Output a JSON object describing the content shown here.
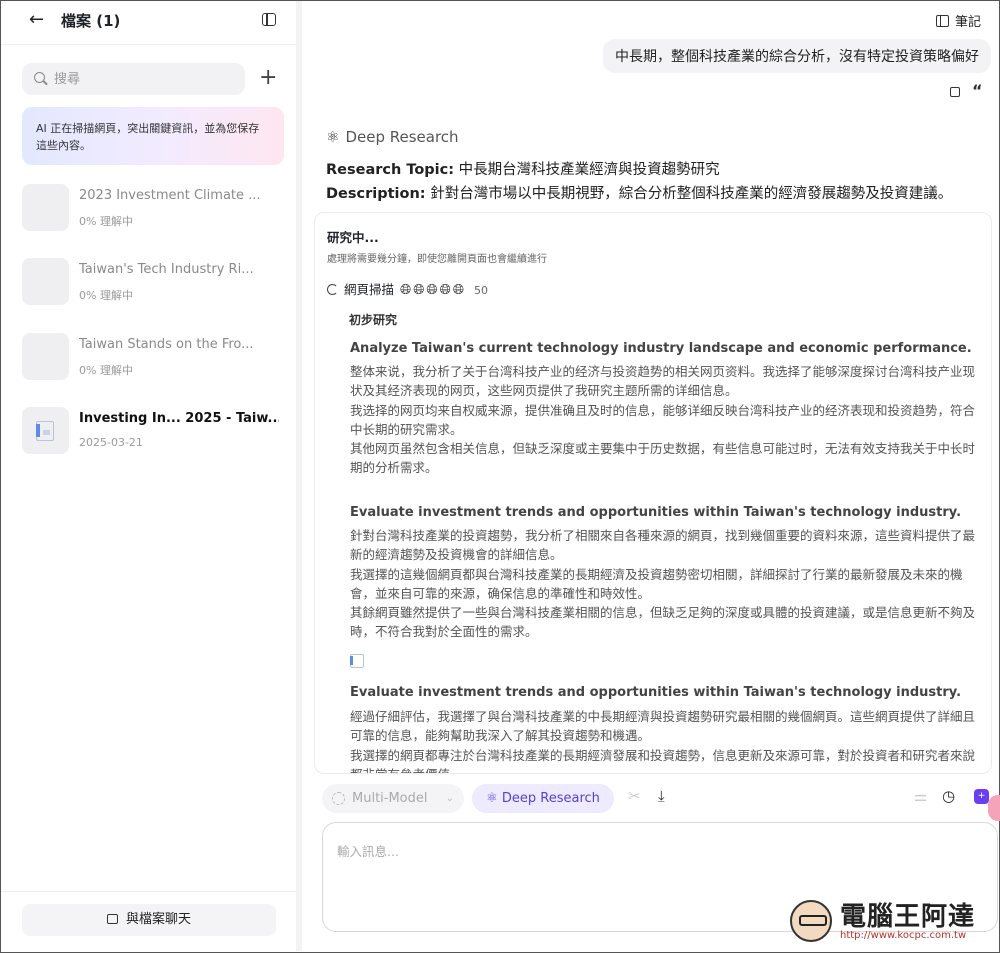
{
  "sidebar": {
    "title": "檔案 (1)",
    "search_placeholder": "搜尋",
    "ai_banner": "AI 正在掃描網頁，突出關鍵資訊，並為您保存這些內容。",
    "docs": [
      {
        "title": "2023 Investment Climate ...",
        "status": "0%  理解中"
      },
      {
        "title": "Taiwan's Tech Industry Ri...",
        "status": "0%  理解中"
      },
      {
        "title": "Taiwan Stands on the Fro...",
        "status": "0%  理解中"
      },
      {
        "title": "Investing In... 2025 - Taiw...",
        "status": "2025-03-21"
      }
    ],
    "chat_button": "與檔案聊天"
  },
  "main": {
    "notes_label": "筆記",
    "user_message": "中長期，整個科技產業的綜合分析，沒有特定投資策略偏好",
    "deep_research_label": "Deep Research",
    "topic_label": "Research Topic:",
    "topic_value": " 中長期台灣科技產業經濟與投資趨勢研究",
    "description_label": "Description:",
    "description_value": " 針對台灣市場以中長期視野，綜合分析整個科技產業的經濟發展趨勢及投資建議。",
    "research": {
      "status_title": "研究中...",
      "status_sub": "處理將需要幾分鐘，即使您離開頁面也會繼續進行",
      "scan_label": "網頁掃描",
      "scan_count": "50",
      "phase": "初步研究",
      "tasks": [
        {
          "title": "Analyze Taiwan's current technology industry landscape and economic performance.",
          "paragraphs": [
            "整体来说，我分析了关于台湾科技产业的经济与投资趋势的相关网页资料。我选择了能够深度探讨台湾科技产业现状及其经济表现的网页，这些网页提供了我研究主题所需的详细信息。",
            "我选择的网页均来自权威来源，提供准确且及时的信息，能够详细反映台湾科技产业的经济表现和投资趋势，符合中长期的研究需求。",
            "其他网页虽然包含相关信息，但缺乏深度或主要集中于历史数据，有些信息可能过时，无法有效支持我关于中长时期的分析需求。"
          ]
        },
        {
          "title": "Evaluate investment trends and opportunities within Taiwan's technology industry.",
          "paragraphs": [
            "針對台灣科技產業的投資趨勢，我分析了相關來自各種來源的網頁，找到幾個重要的資料來源，這些資料提供了最新的經濟趨勢及投資機會的詳細信息。",
            "我選擇的這幾個網頁都與台灣科技產業的長期經濟及投資趨勢密切相關，詳細探討了行業的最新發展及未來的機會，並來自可靠的來源，确保信息的準確性和時效性。",
            "其餘網頁雖然提供了一些與台灣科技產業相關的信息，但缺乏足夠的深度或具體的投資建議，或是信息更新不夠及時，不符合我對於全面性的需求。"
          ]
        },
        {
          "title": "Evaluate investment trends and opportunities within Taiwan's technology industry.",
          "paragraphs": [
            "經過仔細評估，我選擇了與台灣科技產業的中長期經濟與投資趨勢研究最相關的幾個網頁。這些網頁提供了詳細且可靠的信息，能夠幫助我深入了解其投資趨勢和機遇。",
            "我選擇的網頁都專注於台灣科技產業的長期經濟發展和投資趨勢，信息更新及來源可靠，對於投資者和研究者來說都非常有參考價值。"
          ]
        }
      ]
    },
    "toolbar": {
      "model_label": "Multi-Model",
      "deep_research_chip": "Deep Research"
    },
    "input_placeholder": "輸入訊息..."
  },
  "watermark": {
    "text": "電腦王阿達",
    "url": "http://www.kocpc.com.tw"
  }
}
